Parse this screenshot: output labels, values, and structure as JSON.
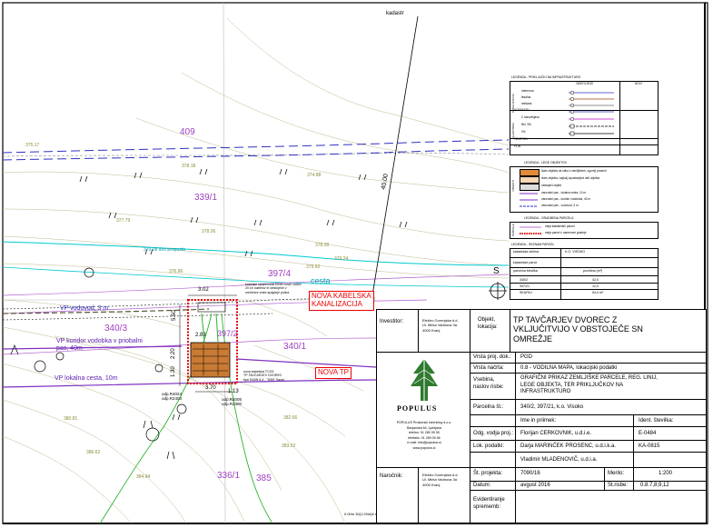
{
  "sheet_corner_label": "kadastr",
  "colors": {
    "contour": "#8c8c3a",
    "parcel": "#a040c0",
    "water": "#00c8d0",
    "road_blue": "#3030c0",
    "green": "#28b428",
    "red": "#e00000",
    "black": "#000000"
  },
  "parcels": [
    "409",
    "339/1",
    "397/4",
    "340/3",
    "340/1",
    "397/2",
    "336/1",
    "385"
  ],
  "contour_labels": [
    "375.17",
    "378.18",
    "374.88",
    "377.79",
    "378.06",
    "378.39",
    "379.24",
    "379.62",
    "376.86",
    "379.08 dno propusta",
    "380.81",
    "382.66",
    "383.52",
    "384.84",
    "386.62"
  ],
  "dimension_40": "40.00",
  "labels": {
    "cesta": "cesta",
    "vp_vodovod": "VP vodovod, 3 m",
    "vp_koridor": "VP koridor vodobka v priobalni pas, 40m",
    "vp_lokalna": "VP lokalna cesta, 10m",
    "kabelska": "NOVA KABELSKA\nKANALIZACIJA",
    "nova_tp": "NOVA TP",
    "dim_302": "3.02",
    "dim_370": "3.70",
    "dim_113": "1.13",
    "dim_283": "2.83",
    "dim_550": "5.50",
    "dim_130": "1.30",
    "dim_220": "2.20",
    "tp_note": "nova kabelska TCI21\nTP TAVČARJEV DVOREC\ntipa SA5N 5-9_ \"50M\" Savel",
    "kab_note": "kabelski vpojni most Elnet-novih vodov\n20 kV kabelov in obstoječe v\nmeritnice vrste-spajanje polica",
    "odp1": "odp.R4024\nodp.R2403",
    "odp2": "odp.R4005\nodp.R2400",
    "north": "S",
    "scale_note": "0.00m 30(1:20m)6 m"
  },
  "legend1": {
    "title": "LEGENDA - PRIKLJUČKI NA INFRASTRUKTURO",
    "col_obs": "OBSTOJEČE",
    "col_new": "NOVI",
    "groups": [
      "KANALIZACIJA",
      "ELEKTRIKA"
    ],
    "rows": [
      "meteorna",
      "fekalna",
      "mešana",
      "VODOVOD",
      "Z razsvetljava",
      "NN, SN",
      "VN",
      "TELEFON",
      "PLIN"
    ]
  },
  "legend2": {
    "title": "LEGENDA - LEGE OBJEKTOV",
    "group": "OBJEKTI",
    "rows": [
      "tloris objekta na stiku z zemljiščem, zgornji prostori",
      "tloris objekta, najbolj izpostavljeni deli objekta",
      "obstoječi objekt",
      "varovalni pas - lokalna cesta, 10 m",
      "varovalni pas - koridor vodotoka, 40 m",
      "varovalni pas - vodovod, 3 m"
    ]
  },
  "legend3": {
    "title": "LEGENDA - GRADBENA PARCELA",
    "group": "PARCELE",
    "rows": [
      "meja katastrskih parcel",
      "meja parcel z namenom gradnje"
    ]
  },
  "legend4": {
    "title": "LEGENDA - SEZNAM PARCEL",
    "ko_label": "katastrska občina",
    "ko_value": "K.O. VISOKO",
    "cols": [
      "parcelna številka",
      "površina (m²)"
    ],
    "subhead": "katastrske parce",
    "rows": [
      [
        "340/2",
        "42,0"
      ],
      [
        "397/21",
        "12,0"
      ]
    ],
    "total_label": "SKUPAJ",
    "total_value": "54,0 m²"
  },
  "title_block": {
    "investitor_label": "Investitor:",
    "investitor_value": "Elektro Gorenjska d.d.\nUl. Mirka Vadnova 3a\n4000 Kranj",
    "objekt_label": "Objekt,\nlokacija:",
    "objekt_value": "TP TAVČARJEV DVOREC Z\nVKLJUČITVIJO V OBSTOJEČE SN\nOMREŽJE",
    "vrsta_proj_label": "Vrsta proj. dok.:",
    "vrsta_proj_value": "PGD",
    "vrsta_nacrta_label": "Vrsta načrta:",
    "vrsta_nacrta_value": "0.8 - VODILNA MAPA, lokacijski podatki",
    "vsebina_label": "Vsebina,\nnaslov risbe:",
    "vsebina_value": "GRAFIČNI PRIKAZ ZEMLJIŠKE PARCELE, REG. LINIJ,\nLEGE OBJEKTA, TER PRIKLJUČKOV NA\nINFRASTRUKTURO",
    "parcelna_label": "Parcelna št.:",
    "parcelna_value": "340/2, 397/21, k.o. Visoko",
    "ime_label": "Ime in priimek:",
    "ident_label": "Ident. številka:",
    "odg_label": "Odg. vodja proj.:",
    "odg_name": "Florijan CERKOVNIK, u.d.i.e.",
    "odg_id": "E-0484",
    "lok_label": "Lok. podatki:",
    "lok_name": "Darja MARINČEK PROSENC, u.d.i.k.a.",
    "lok_id": "KA-0815",
    "third_name": "Vladimir MLADENOVIČ, u.d.i.a.",
    "narocnik_label": "Naročnik:",
    "narocnik_value": "Elektro Gorenjska d.d.\nUl. Mirka Vadnova 3a\n4000 Kranj",
    "st_proj_label": "Št. projekta:",
    "st_proj_value": "7090/16",
    "merilo_label": "Merilo:",
    "merilo_value": "1:200",
    "datum_label": "Datum:",
    "datum_value": "avgust 2016",
    "st_risbe_label": "Št.risbe:",
    "st_risbe_value": "0.8.7,8,9,12",
    "evid_label": "Evidentiranje\nsprememb:",
    "logo_text": "POPULUS",
    "company": "POPULUS Prostorski inženiring d.o.o.\nBavjanska 64, Ljubljana\ntelefon: 01 280 05 50\ntelefaks: 01 280 05 56\ne-mail: info@populus.si\nwww.populus.si"
  }
}
